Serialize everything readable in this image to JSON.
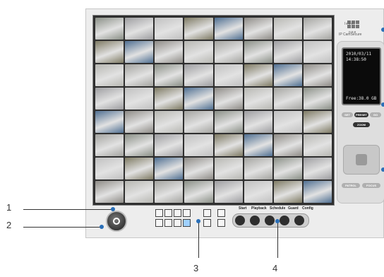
{
  "brand": {
    "word": "level",
    "word2": "one",
    "subtitle": "IP CamSecure"
  },
  "monitor": {
    "date": "2010/03/11",
    "time": "14:38:50",
    "free": "Free:38.0 GB"
  },
  "ptz": {
    "set": "SET",
    "preset": "PRESET",
    "go": "GO",
    "zoom": "ZOOM",
    "patrol": "PATROL",
    "focus": "FOCUS"
  },
  "controls": {
    "labels": [
      "Start",
      "Playback",
      "Schedule",
      "Guard",
      "Config"
    ]
  },
  "callouts": [
    "1",
    "2",
    "3",
    "4"
  ],
  "camera_tile_colors": [
    "#8a8f86",
    "#7e7a63",
    "#b7b7b2",
    "#9d9da0",
    "#4f6f92",
    "#a4a4a0",
    "#c0c0c0",
    "#8e8b86"
  ]
}
